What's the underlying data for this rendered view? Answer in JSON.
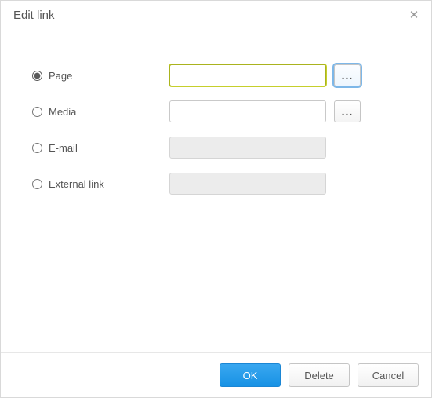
{
  "dialog": {
    "title": "Edit link",
    "close_tooltip": "Close"
  },
  "options": [
    {
      "id": "page",
      "label": "Page",
      "value": "",
      "placeholder": "",
      "browse": true,
      "enabled": true,
      "selected": true,
      "focused": true
    },
    {
      "id": "media",
      "label": "Media",
      "value": "",
      "placeholder": "",
      "browse": true,
      "enabled": true,
      "selected": false,
      "focused": false
    },
    {
      "id": "email",
      "label": "E-mail",
      "value": "",
      "placeholder": "",
      "browse": false,
      "enabled": false,
      "selected": false,
      "focused": false
    },
    {
      "id": "external",
      "label": "External link",
      "value": "",
      "placeholder": "",
      "browse": false,
      "enabled": false,
      "selected": false,
      "focused": false
    }
  ],
  "browse_glyph": "...",
  "buttons": {
    "ok": "OK",
    "delete": "Delete",
    "cancel": "Cancel"
  }
}
